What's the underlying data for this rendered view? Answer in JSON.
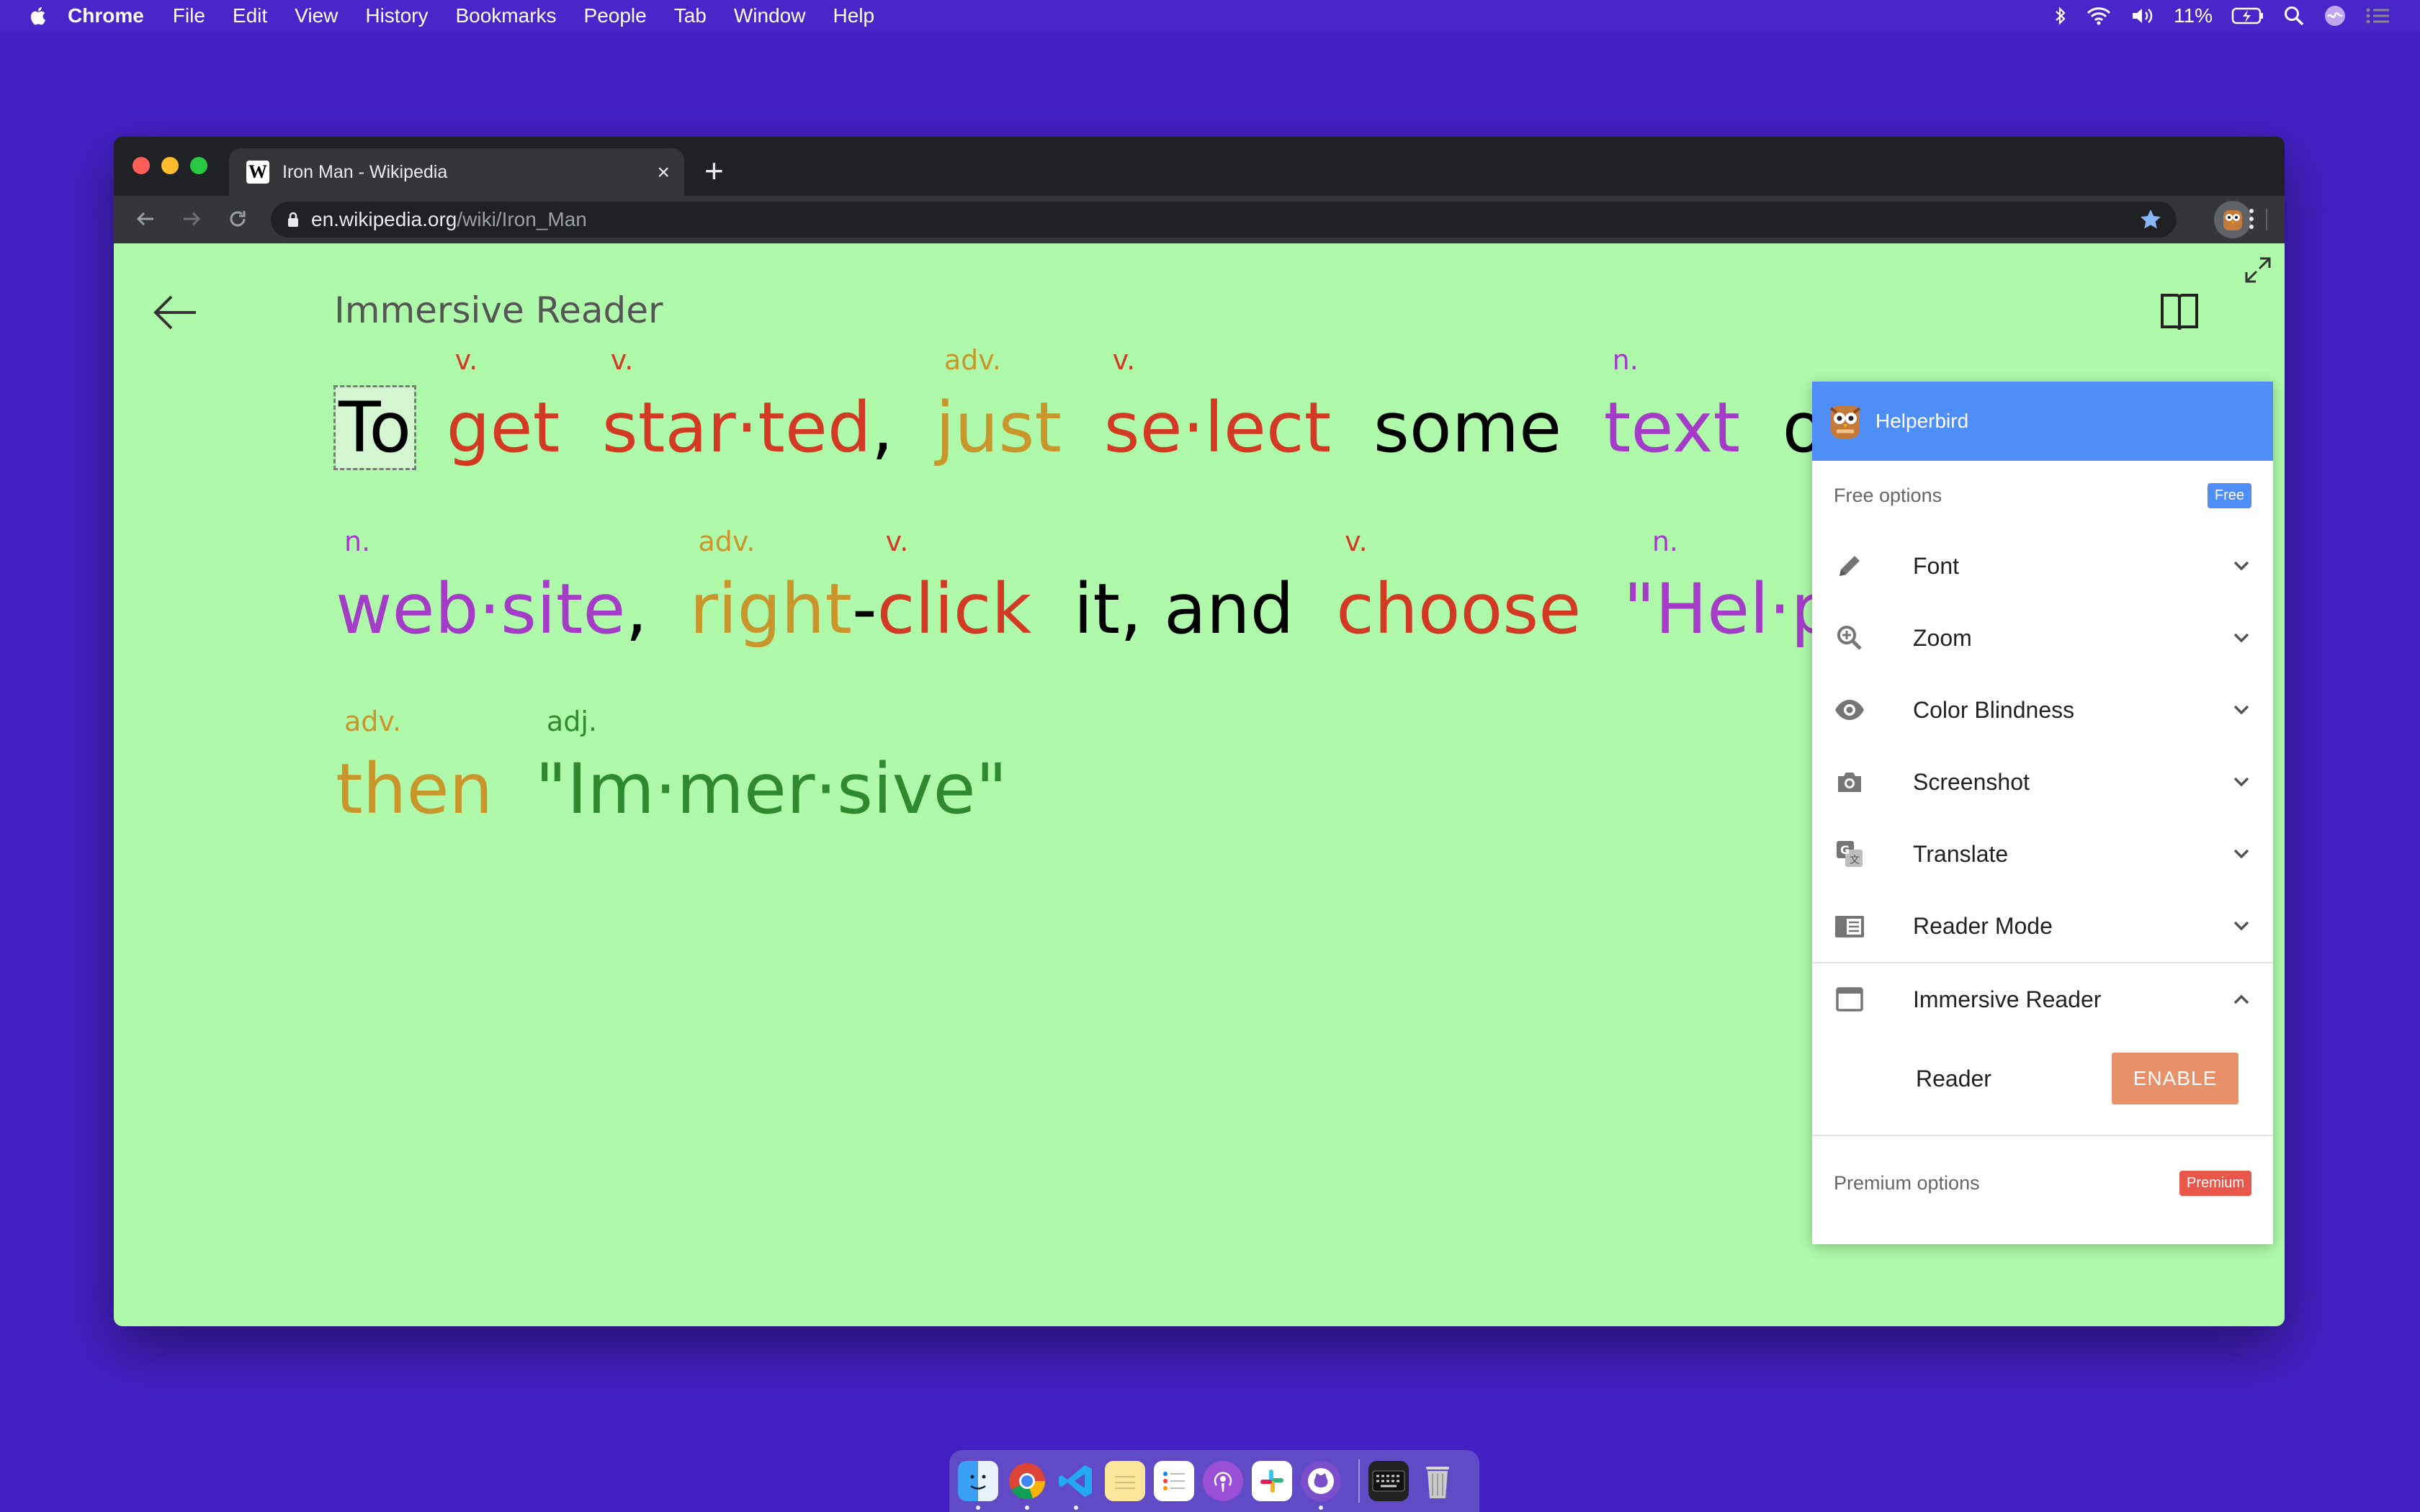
{
  "menubar": {
    "app_name": "Chrome",
    "items": [
      "File",
      "Edit",
      "View",
      "History",
      "Bookmarks",
      "People",
      "Tab",
      "Window",
      "Help"
    ],
    "battery": "11%"
  },
  "browser": {
    "tab_title": "Iron Man - Wikipedia",
    "url_host": "en.wikipedia.org",
    "url_path": "/wiki/Iron_Man"
  },
  "reader": {
    "title": "Immersive Reader",
    "lines": [
      [
        {
          "text": "To",
          "pos": "",
          "color": "#000000",
          "highlight": true
        },
        {
          "text": "get",
          "pos": "v.",
          "color": "#d23a24"
        },
        {
          "text": "star·ted",
          "pos": "v.",
          "color": "#d23a24"
        },
        {
          "text": ",",
          "pos": "",
          "color": "#000000"
        },
        {
          "text": "just",
          "pos": "adv.",
          "color": "#c9962c"
        },
        {
          "text": "se·lect",
          "pos": "v.",
          "color": "#d23a24"
        },
        {
          "text": "some",
          "pos": "",
          "color": "#000000"
        },
        {
          "text": "text",
          "pos": "n.",
          "color": "#a43cc8"
        },
        {
          "text": "o",
          "pos": "",
          "color": "#000000"
        }
      ],
      [
        {
          "text": "web·site",
          "pos": "n.",
          "color": "#a43cc8"
        },
        {
          "text": ",",
          "pos": "",
          "color": "#000000"
        },
        {
          "text": "right",
          "pos": "adv.",
          "color": "#c9962c"
        },
        {
          "text": "-",
          "pos": "",
          "color": "#000000"
        },
        {
          "text": "click",
          "pos": "v.",
          "color": "#d23a24"
        },
        {
          "text": "it, and",
          "pos": "",
          "color": "#000000"
        },
        {
          "text": "choose",
          "pos": "v.",
          "color": "#d23a24"
        },
        {
          "text": "\"Hel·p",
          "pos": "n.",
          "color": "#a43cc8"
        }
      ],
      [
        {
          "text": "then",
          "pos": "adv.",
          "color": "#c9962c"
        },
        {
          "text": "\"Im·mer·sive\"",
          "pos": "adj.",
          "color": "#2f8a2f"
        }
      ]
    ]
  },
  "popup": {
    "header": "Helperbird",
    "free_label": "Free options",
    "free_badge": "Free",
    "options": [
      {
        "label": "Font",
        "icon": "pencil-icon"
      },
      {
        "label": "Zoom",
        "icon": "zoom-icon"
      },
      {
        "label": "Color Blindness",
        "icon": "eye-icon"
      },
      {
        "label": "Screenshot",
        "icon": "camera-icon"
      },
      {
        "label": "Translate",
        "icon": "translate-icon"
      },
      {
        "label": "Reader Mode",
        "icon": "reader-mode-icon"
      }
    ],
    "expanded_option": {
      "label": "Immersive Reader",
      "icon": "window-icon"
    },
    "reader_label": "Reader",
    "enable_label": "ENABLE",
    "premium_label": "Premium options",
    "premium_badge": "Premium"
  },
  "colors": {
    "desktop": "#4420c4",
    "page_bg": "#aefaaa",
    "popup_header": "#4f8ef7",
    "enable_button": "#e8906a",
    "premium_badge": "#e8574a",
    "free_badge": "#4f8ef7"
  }
}
